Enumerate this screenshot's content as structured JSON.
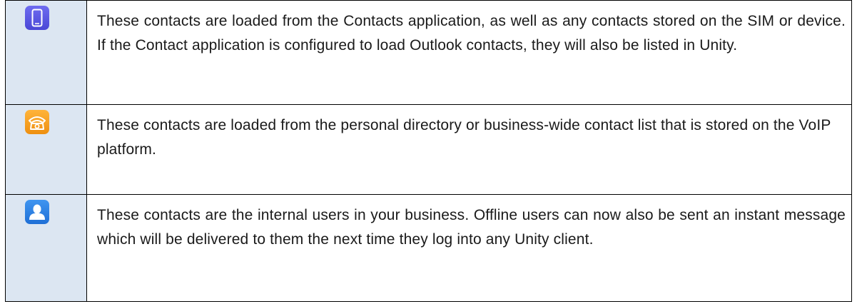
{
  "rows": [
    {
      "icon": "mobile-phone-icon",
      "icon_color": "#5a57e0",
      "text": "These contacts are loaded from the Contacts application, as well as any contacts stored on the SIM or device. If the Contact application is configured to load Outlook contacts, they will also be listed in Unity."
    },
    {
      "icon": "desk-phone-icon",
      "icon_color": "#f5a01e",
      "text": "These contacts are loaded from the personal directory or business-wide contact list that is stored on the VoIP platform."
    },
    {
      "icon": "user-icon",
      "icon_color": "#2f84e6",
      "text": "These contacts are the internal users in your business. Offline users can now also be sent an instant message which will be delivered to them the next time they log into any Unity client."
    }
  ],
  "colors": {
    "icon_column_bg": "#dce6f2",
    "border": "#000000",
    "text": "#1a1a1a"
  }
}
